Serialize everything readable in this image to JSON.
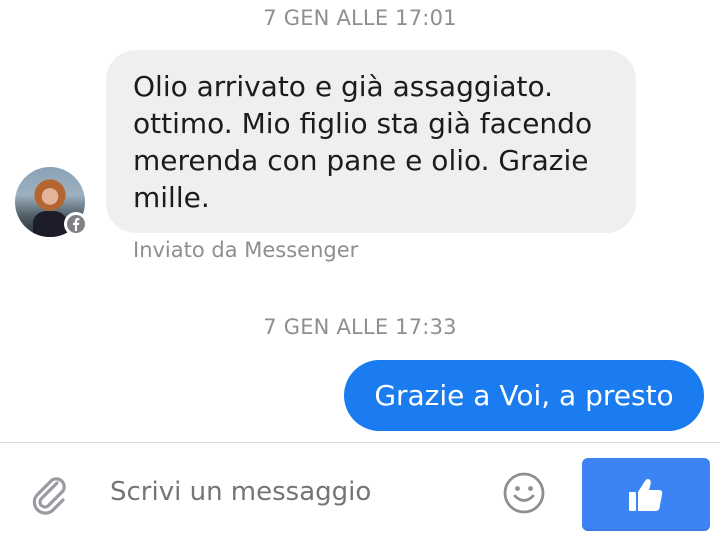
{
  "conversation": {
    "timestamps": [
      "7 GEN ALLE 17:01",
      "7 GEN ALLE 17:33"
    ],
    "incoming": {
      "lines": [
        "Olio arrivato e già assaggiato.",
        "ottimo. Mio figlio sta già facendo",
        "merenda con pane e olio. Grazie",
        "mille."
      ],
      "sent_via": "Inviato da Messenger",
      "sender_badge_icon": "facebook-icon"
    },
    "outgoing": {
      "text": "Grazie a Voi, a presto"
    }
  },
  "composer": {
    "placeholder": "Scrivi un messaggio",
    "value": "",
    "attach_icon": "paperclip-icon",
    "emoji_icon": "smiley-icon",
    "send_icon": "thumbs-up-icon"
  },
  "colors": {
    "outgoing_bubble": "#1a7cf0",
    "incoming_bubble": "#efefef",
    "like_button": "#3c84f4",
    "meta_text": "#8e8e93"
  }
}
